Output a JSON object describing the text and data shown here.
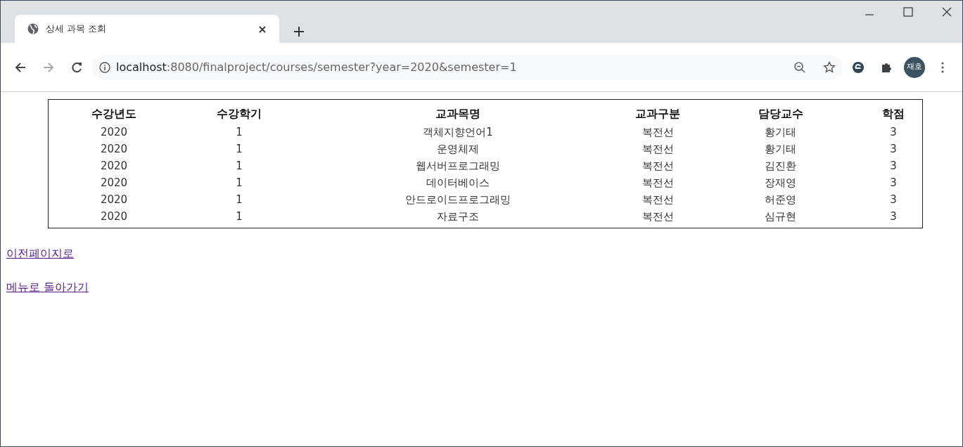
{
  "browser": {
    "tab": {
      "title": "상세 과목 조회",
      "selected": true
    },
    "url": {
      "host": "localhost",
      "rest": ":8080/finalproject/courses/semester?year=2020&semester=1"
    },
    "profile": "재호"
  },
  "table": {
    "columns": [
      "수강년도",
      "수강학기",
      "교과목명",
      "교과구분",
      "담당교수",
      "학점"
    ],
    "rows": [
      [
        "2020",
        "1",
        "객체지향언어1",
        "복전선",
        "황기태",
        "3"
      ],
      [
        "2020",
        "1",
        "운영체제",
        "복전선",
        "황기태",
        "3"
      ],
      [
        "2020",
        "1",
        "웹서버프로그래밍",
        "복전선",
        "김진환",
        "3"
      ],
      [
        "2020",
        "1",
        "데이터베이스",
        "복전선",
        "장재영",
        "3"
      ],
      [
        "2020",
        "1",
        "안드로이드프로그래밍",
        "복전선",
        "허준영",
        "3"
      ],
      [
        "2020",
        "1",
        "자료구조",
        "복전선",
        "심규현",
        "3"
      ]
    ]
  },
  "links": [
    "이전페이지로",
    "메뉴로 돌아가기"
  ]
}
